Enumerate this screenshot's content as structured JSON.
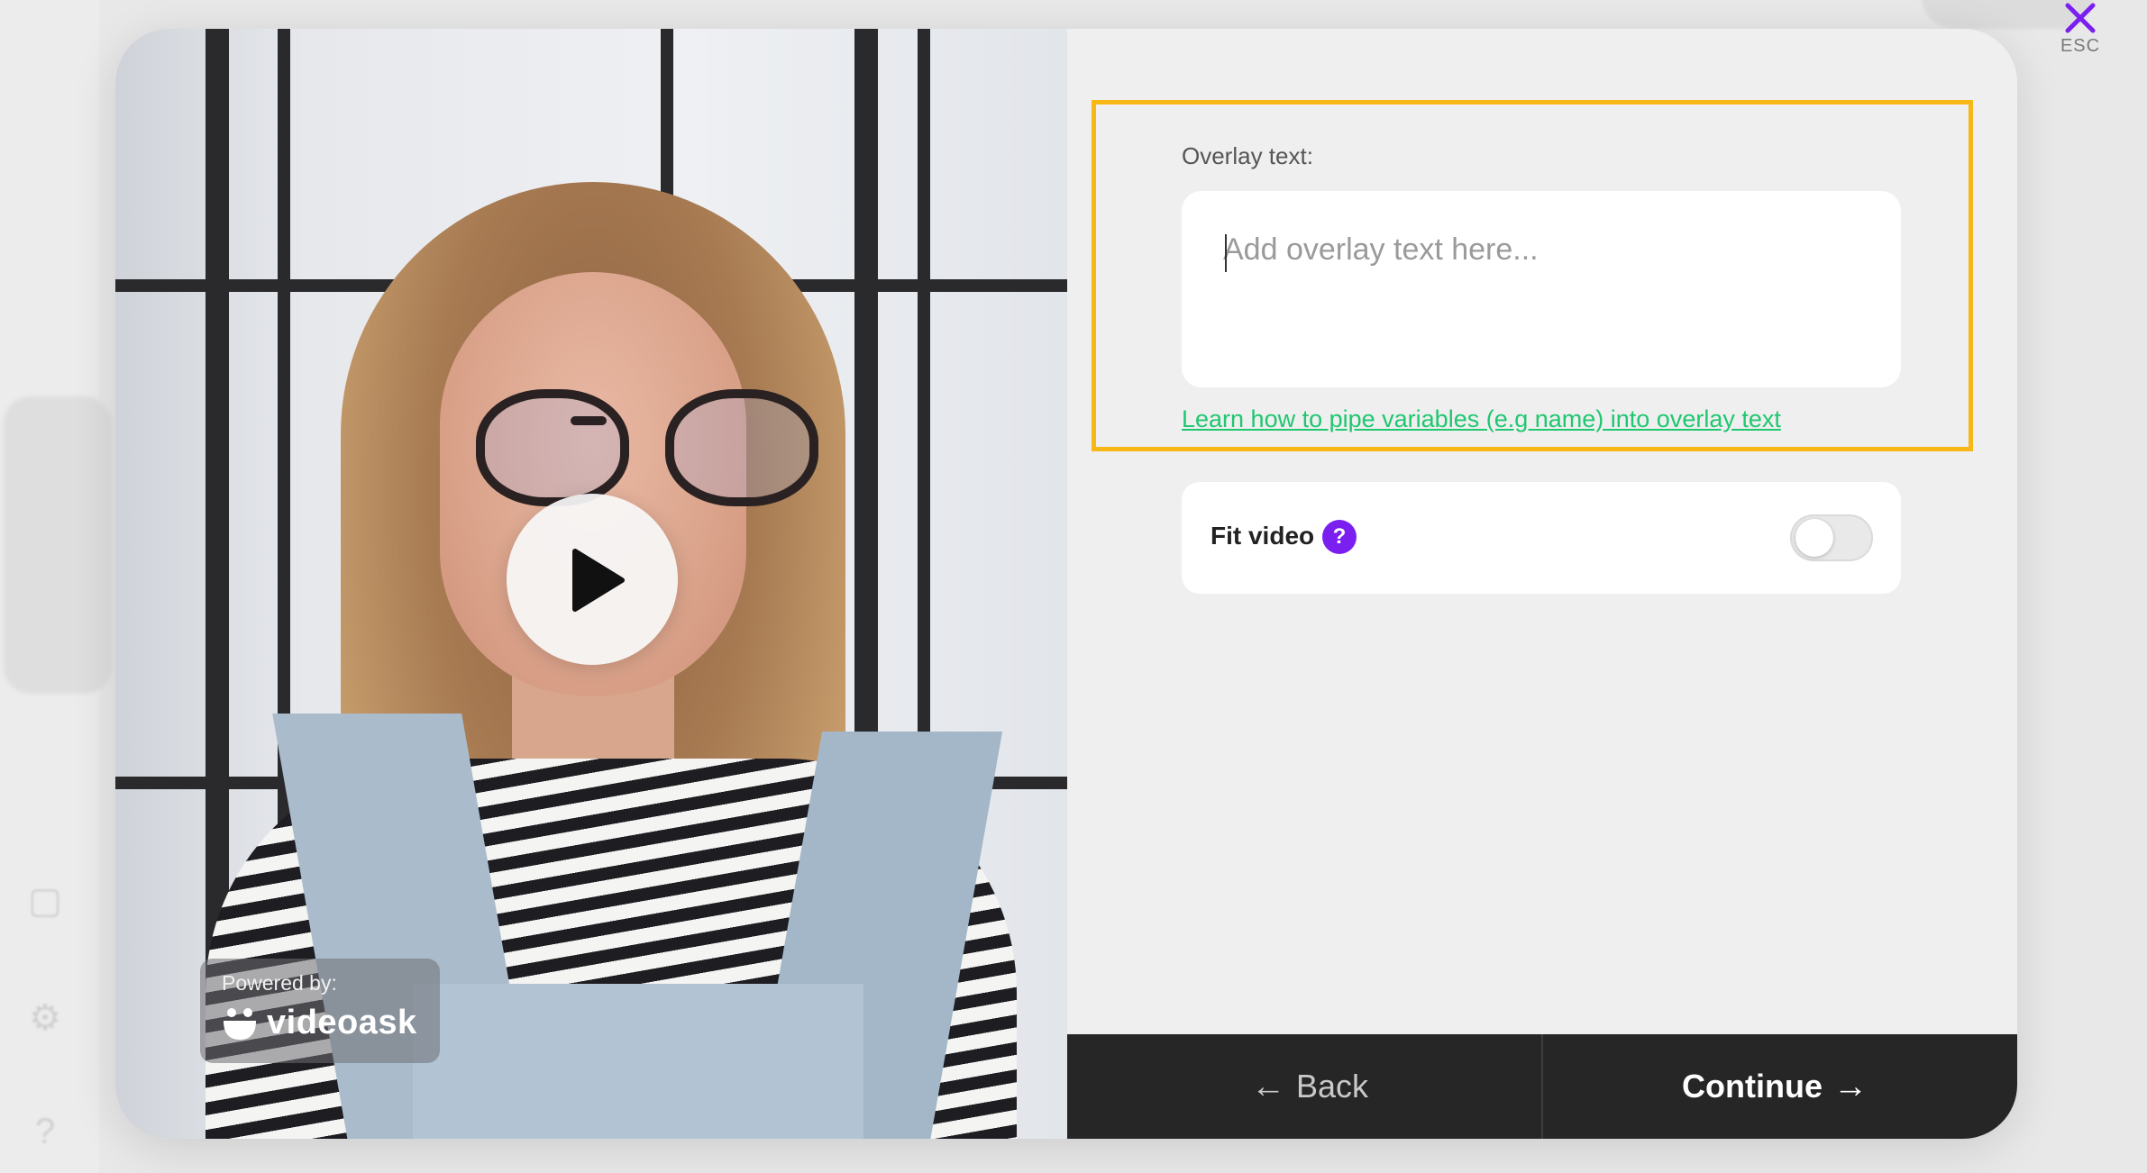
{
  "close": {
    "esc_label": "ESC",
    "color": "#7a1ff0"
  },
  "video": {
    "powered_by_label": "Powered by:",
    "brand_name": "videoask",
    "play_icon": "play-icon"
  },
  "settings": {
    "overlay_label": "Overlay text:",
    "overlay_placeholder": "Add overlay text here...",
    "overlay_value": "",
    "pipe_link": "Learn how to pipe variables (e.g name) into overlay text",
    "fit_video_label": "Fit video",
    "fit_video_help": "?",
    "fit_video_enabled": false,
    "highlight_color": "#f7b715",
    "link_color": "#1fc770"
  },
  "footer": {
    "back_label": "Back",
    "continue_label": "Continue"
  }
}
